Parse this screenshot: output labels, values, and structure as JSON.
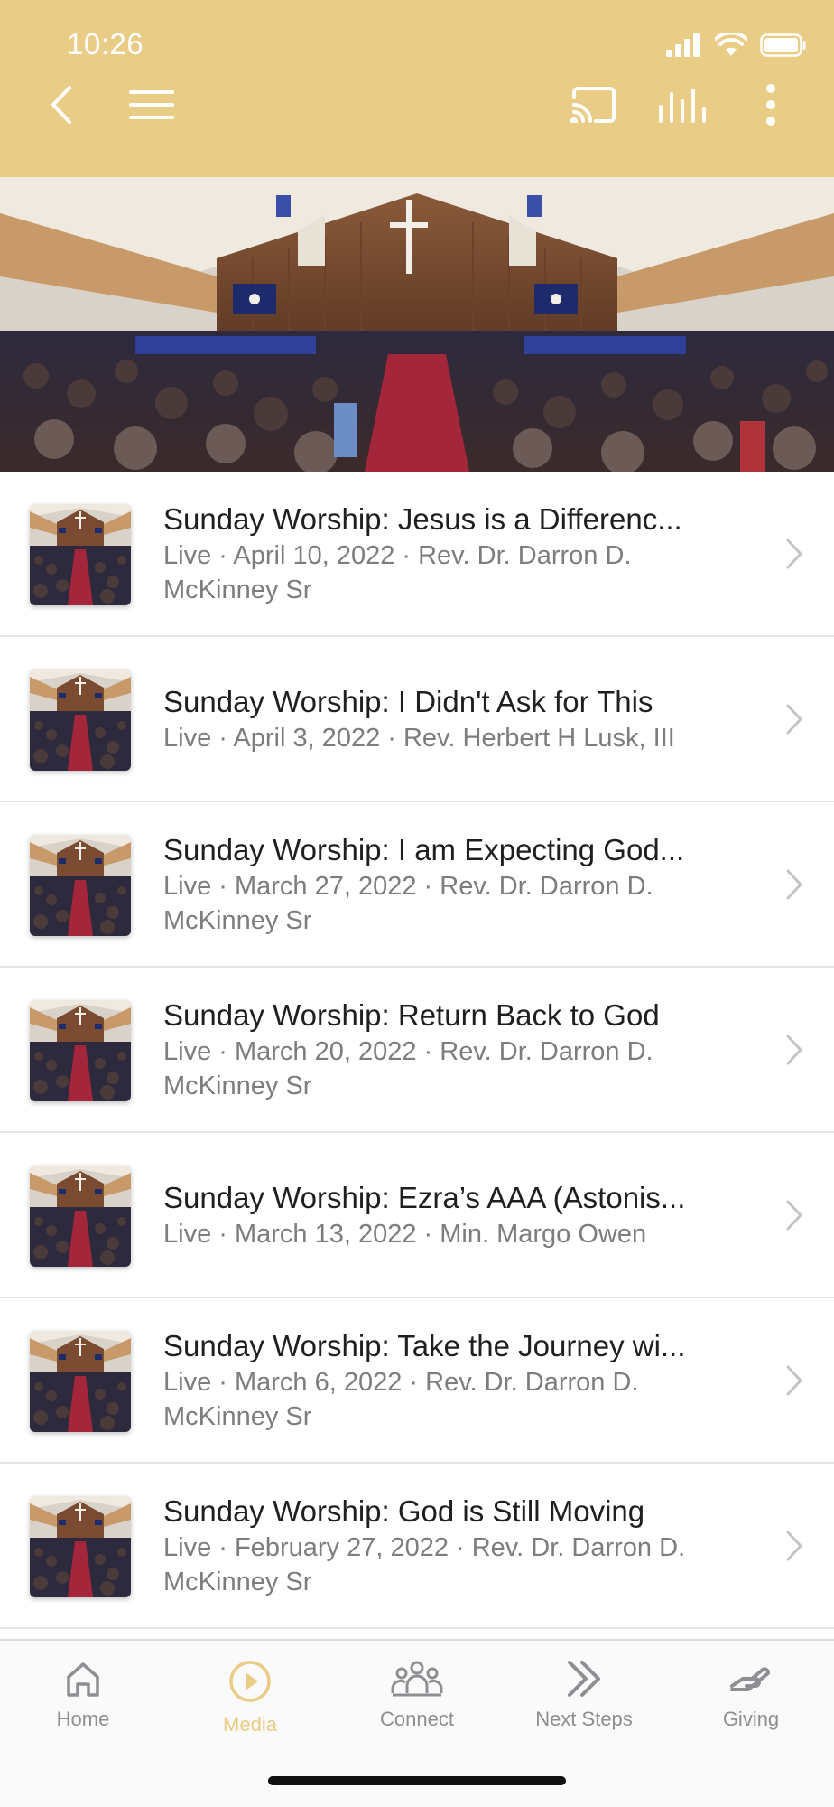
{
  "status_bar": {
    "time": "10:26"
  },
  "header": {
    "back_icon": "chevron-left-icon",
    "menu_icon": "hamburger-icon",
    "cast_icon": "cast-icon",
    "audio_icon": "equalizer-icon",
    "more_icon": "more-vertical-icon",
    "background_color": "#e9cc86"
  },
  "sermons": [
    {
      "title": "Sunday Worship: Jesus is a Differenc...",
      "meta": "Live · April 10, 2022 · Rev. Dr. Darron D. McKinney Sr"
    },
    {
      "title": "Sunday Worship: I Didn't Ask for This",
      "meta": "Live · April 3, 2022 · Rev. Herbert H Lusk, III"
    },
    {
      "title": "Sunday Worship: I am Expecting God...",
      "meta": "Live · March 27, 2022 · Rev. Dr. Darron D. McKinney Sr"
    },
    {
      "title": "Sunday Worship: Return Back to God",
      "meta": "Live · March 20, 2022 · Rev. Dr. Darron D. McKinney Sr"
    },
    {
      "title": "Sunday Worship: Ezra’s AAA (Astonis...",
      "meta": "Live · March 13, 2022 · Min. Margo Owen"
    },
    {
      "title": "Sunday Worship: Take the Journey wi...",
      "meta": "Live · March 6, 2022 · Rev. Dr. Darron D. McKinney Sr"
    },
    {
      "title": "Sunday Worship: God is Still Moving",
      "meta": "Live · February 27, 2022 · Rev. Dr. Darron D. McKinney Sr"
    }
  ],
  "tabs": [
    {
      "label": "Home",
      "icon": "home-icon"
    },
    {
      "label": "Media",
      "icon": "play-circle-icon",
      "active": true
    },
    {
      "label": "Connect",
      "icon": "people-icon"
    },
    {
      "label": "Next Steps",
      "icon": "double-chevron-right-icon"
    },
    {
      "label": "Giving",
      "icon": "giving-hand-icon"
    }
  ],
  "colors": {
    "accent": "#e9cc86",
    "tab_inactive": "#8e8e93"
  }
}
